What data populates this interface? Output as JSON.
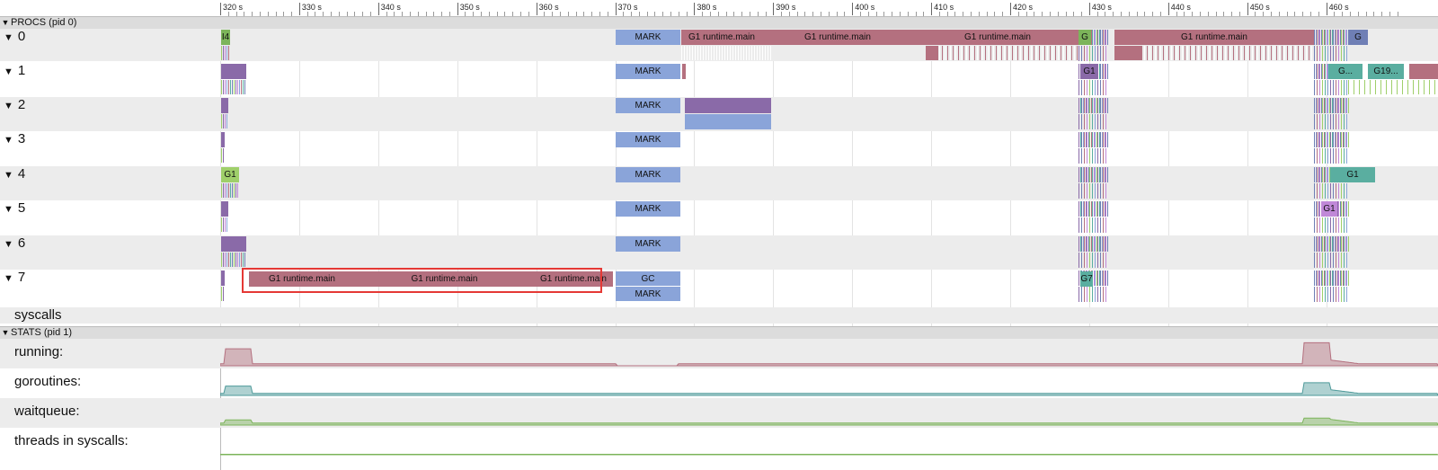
{
  "ruler": {
    "ticks": [
      "320 s",
      "330 s",
      "340 s",
      "350 s",
      "360 s",
      "370 s",
      "380 s",
      "390 s",
      "400 s",
      "410 s",
      "420 s",
      "430 s",
      "440 s",
      "450 s",
      "460 s"
    ]
  },
  "sections": {
    "procs": {
      "label": "PROCS (pid 0)"
    },
    "stats": {
      "label": "STATS (pid 1)"
    }
  },
  "procs": [
    {
      "label": "0",
      "expanded": true
    },
    {
      "label": "1",
      "expanded": true
    },
    {
      "label": "2",
      "expanded": true
    },
    {
      "label": "3",
      "expanded": true
    },
    {
      "label": "4",
      "expanded": true
    },
    {
      "label": "5",
      "expanded": true
    },
    {
      "label": "6",
      "expanded": true
    },
    {
      "label": "7",
      "expanded": true
    }
  ],
  "syscalls": {
    "label": "syscalls"
  },
  "stats": [
    {
      "label": "running:",
      "color": "#b4707f"
    },
    {
      "label": "goroutines:",
      "color": "#4e9a9a"
    },
    {
      "label": "waitqueue:",
      "color": "#7cb45a"
    },
    {
      "label": "threads in syscalls:",
      "color": "#7cb45a"
    }
  ],
  "slice_labels": {
    "mark": "MARK",
    "gc": "GC",
    "g1_runtime_main": "G1 runtime.main",
    "g1": "G1",
    "g": "G",
    "g7": "G7",
    "g_ellipsis": "G...",
    "g19_ellipsis": "G19...",
    "i4": "I4",
    "g_trunc": "G"
  },
  "colors": {
    "mark": "#8aa4d9",
    "g1_runtime": "#b4707f",
    "selection": "#e53935",
    "green": "#9fcf6a",
    "teal": "#5aaea0",
    "purple": "#8a6aa8"
  }
}
